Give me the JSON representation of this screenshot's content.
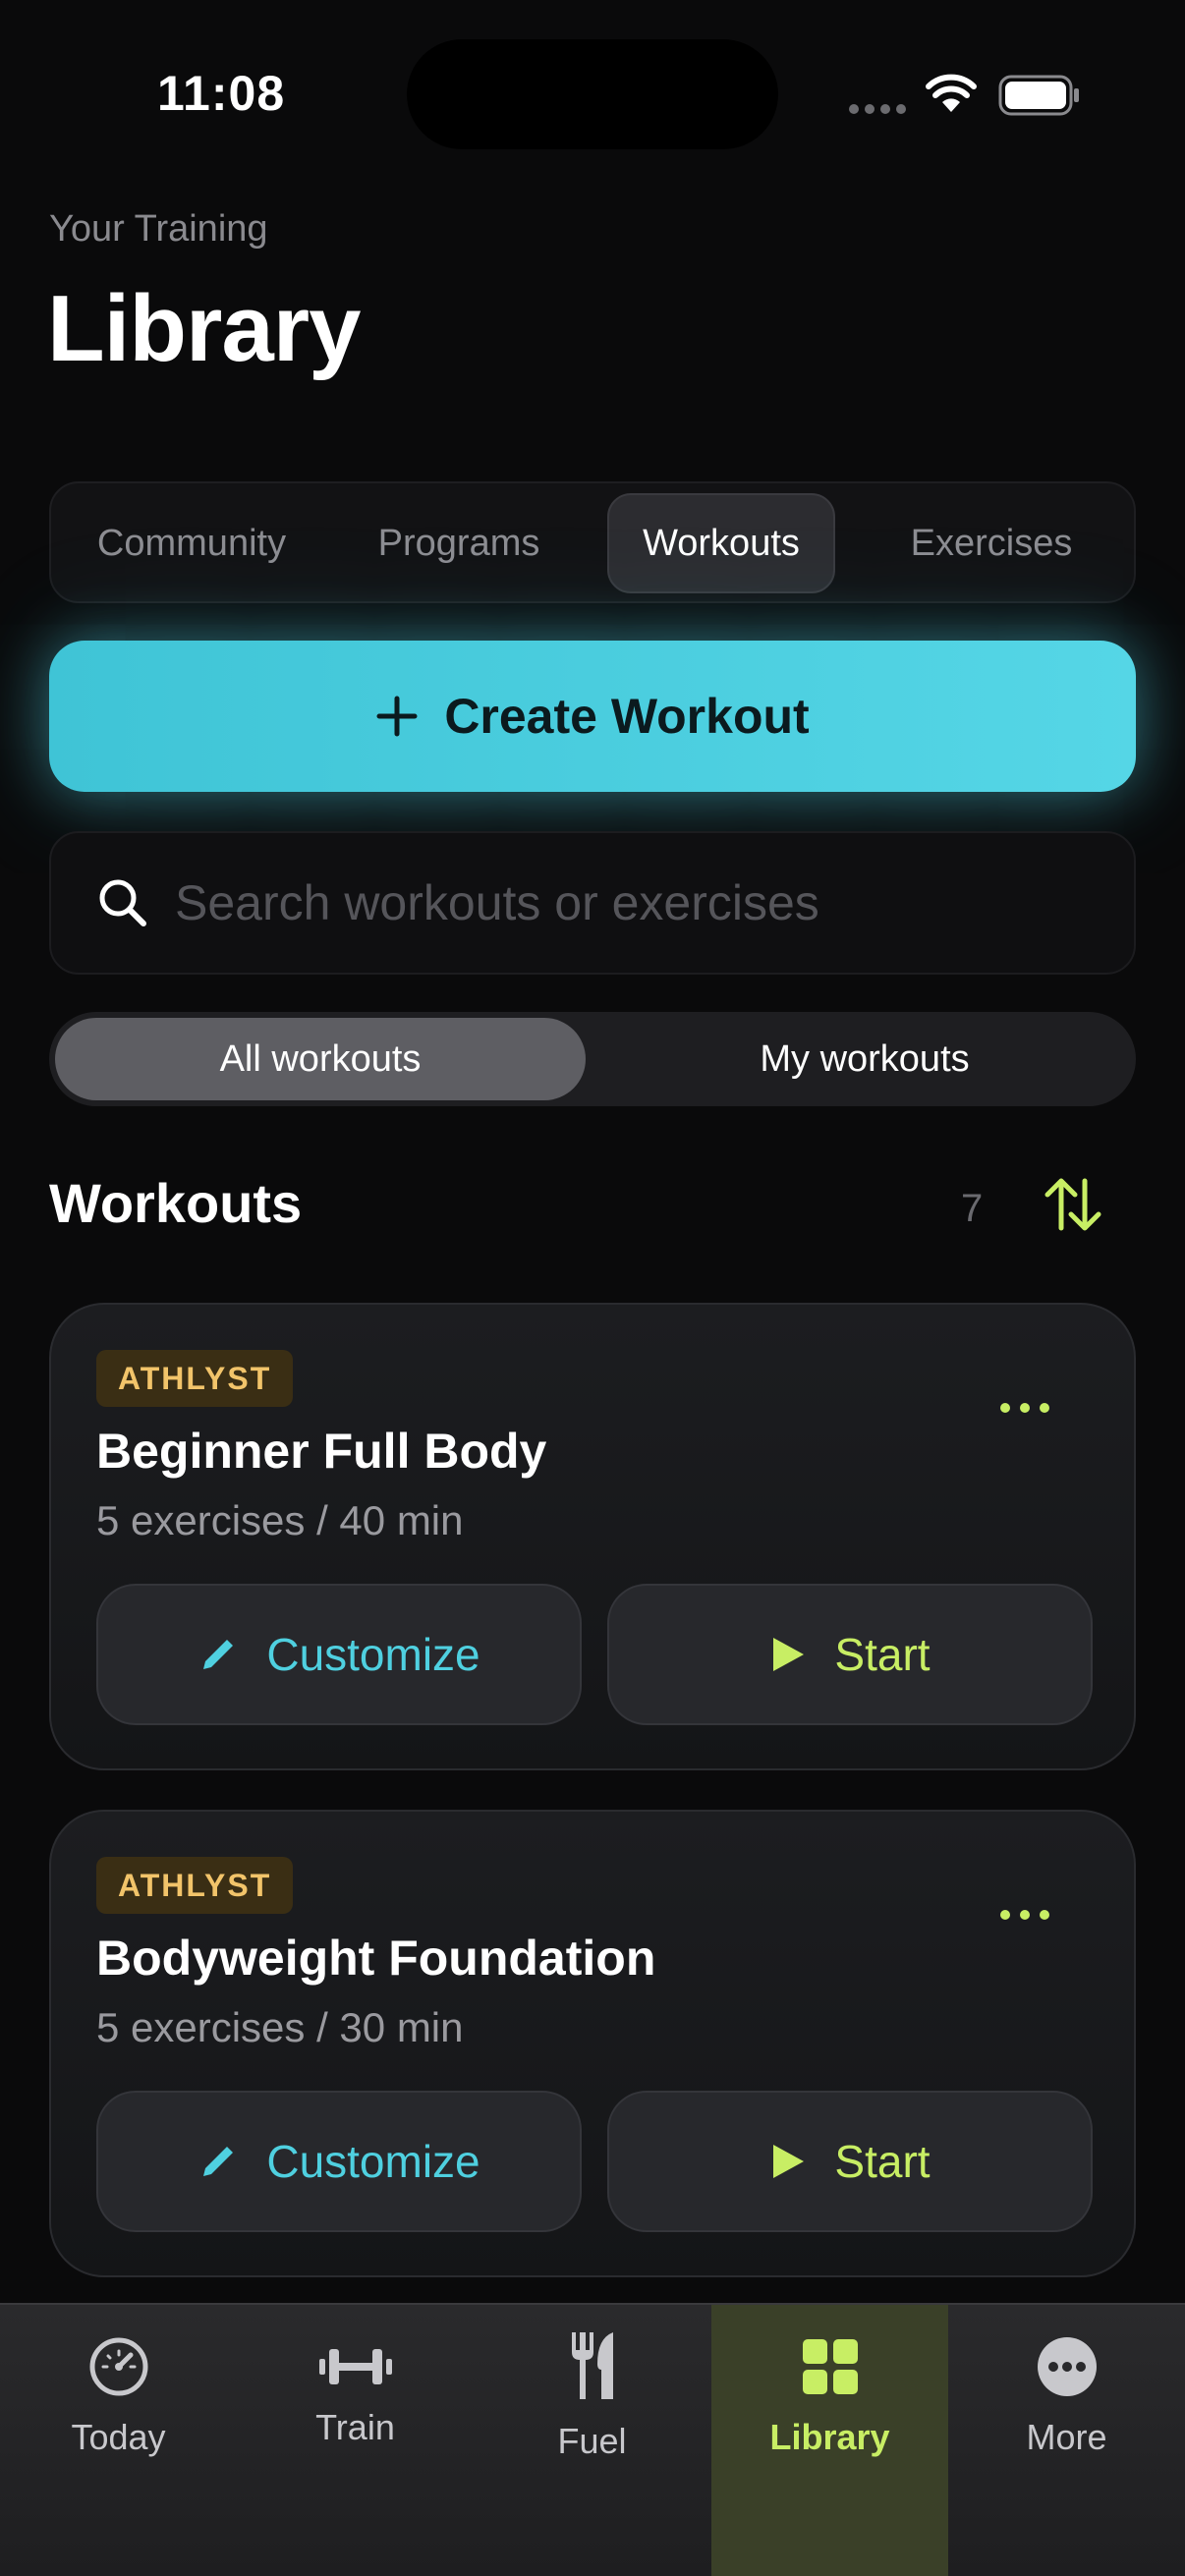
{
  "status_bar": {
    "time": "11:08"
  },
  "header": {
    "eyebrow": "Your Training",
    "title": "Library"
  },
  "tabs": [
    {
      "label": "Community",
      "active": false
    },
    {
      "label": "Programs",
      "active": false
    },
    {
      "label": "Workouts",
      "active": true
    },
    {
      "label": "Exercises",
      "active": false
    }
  ],
  "create_button": {
    "label": "Create Workout",
    "icon": "plus-icon"
  },
  "search": {
    "placeholder": "Search workouts or exercises",
    "value": ""
  },
  "filter": {
    "options": [
      "All workouts",
      "My workouts"
    ],
    "selected": "All workouts"
  },
  "section": {
    "title": "Workouts",
    "count": "7"
  },
  "workouts": [
    {
      "badge": "ATHLYST",
      "title": "Beginner Full Body",
      "meta": "5 exercises / 40 min",
      "customize_label": "Customize",
      "start_label": "Start"
    },
    {
      "badge": "ATHLYST",
      "title": "Bodyweight Foundation",
      "meta": "5 exercises / 30 min",
      "customize_label": "Customize",
      "start_label": "Start"
    }
  ],
  "nav": [
    {
      "label": "Today",
      "icon": "speedometer-icon",
      "active": false
    },
    {
      "label": "Train",
      "icon": "dumbbell-icon",
      "active": false
    },
    {
      "label": "Fuel",
      "icon": "fork-knife-icon",
      "active": false
    },
    {
      "label": "Library",
      "icon": "grid-icon",
      "active": true
    },
    {
      "label": "More",
      "icon": "ellipsis-circle-icon",
      "active": false
    }
  ],
  "colors": {
    "accent_cyan": "#4fd0e0",
    "accent_lime": "#c8ee64",
    "badge_text": "#f2c46a",
    "background": "#0a0a0b"
  }
}
